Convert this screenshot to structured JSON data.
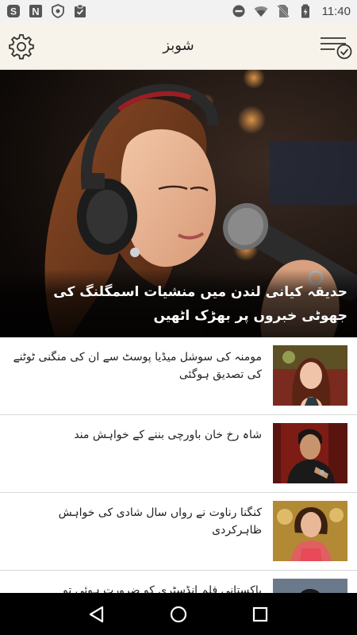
{
  "status_bar": {
    "time": "11:40",
    "left_icons": [
      "skype-icon",
      "n-icon",
      "shield-icon",
      "clipboard-icon"
    ],
    "right_icons": [
      "dnd-icon",
      "wifi-icon",
      "no-sim-icon",
      "battery-icon"
    ]
  },
  "app_bar": {
    "title": "شوبز"
  },
  "hero": {
    "title": "حدیقہ کیانی لندن میں منشیات اسمگلنگ کی جھوٹی خبروں پر بھڑک اٹھیں"
  },
  "news": [
    {
      "title": "مومنہ کی سوشل میڈیا پوسٹ سے ان کی منگنی ٹوٹنے کی تصدیق ہوگئی"
    },
    {
      "title": "شاہ رخ خان باورچی بننے کے خواہش مند"
    },
    {
      "title": "کنگنا رناوت نے رواں سال شادی کی خواہش ظاہرکردی"
    },
    {
      "title": "پاکستانی فلم انڈسٹری کو ضرورت ہوئی تو"
    }
  ],
  "nav": {
    "buttons": [
      "back-icon",
      "home-icon",
      "recents-icon"
    ]
  },
  "colors": {
    "app_bar_bg": "#f7f3ea",
    "status_bar_bg": "#f2f2f2",
    "nav_bar_bg": "#000000"
  }
}
